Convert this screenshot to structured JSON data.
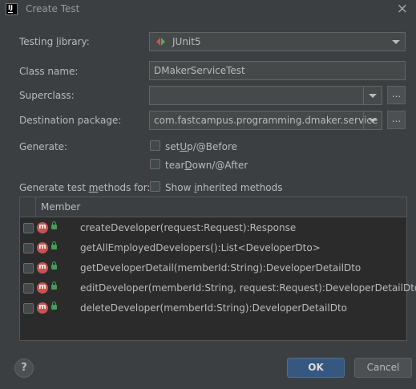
{
  "window": {
    "title": "Create Test",
    "app_icon_text": "IJ"
  },
  "form": {
    "testing_library": {
      "label_pre": "Testing ",
      "label_u": "l",
      "label_post": "ibrary:",
      "value": "JUnit5"
    },
    "class_name": {
      "label": "Class name:",
      "value": "DMakerServiceTest"
    },
    "superclass": {
      "label": "Superclass:",
      "value": ""
    },
    "destination_package": {
      "label": "Destination package:",
      "value": "com.fastcampus.programming.dmaker.service"
    },
    "browse_label": "...",
    "generate": {
      "label": "Generate:",
      "setup": {
        "pre": "set",
        "u": "U",
        "post": "p/@Before"
      },
      "teardown": {
        "pre": "tear",
        "u": "D",
        "post": "own/@After"
      }
    },
    "generate_methods": {
      "label_pre": "Generate test ",
      "label_u": "m",
      "label_post": "ethods for:"
    },
    "show_inherited": {
      "pre": "Show ",
      "u": "i",
      "post": "nherited methods"
    }
  },
  "members": {
    "header": "Member",
    "icon_letter": "m",
    "rows": [
      "createDeveloper(request:Request):Response",
      "getAllEmployedDevelopers():List<DeveloperDto>",
      "getDeveloperDetail(memberId:String):DeveloperDetailDto",
      "editDeveloper(memberId:String, request:Request):DeveloperDetailDto",
      "deleteDeveloper(memberId:String):DeveloperDetailDto"
    ]
  },
  "buttons": {
    "help": "?",
    "ok": "OK",
    "cancel": "Cancel"
  },
  "colors": {
    "background": "#3c3f41",
    "field": "#45494a",
    "accent": "#365880",
    "method_icon": "#c75450",
    "lock_icon": "#499c54"
  },
  "icons": [
    "app-icon",
    "close-icon",
    "junit-icon",
    "chevron-down-icon",
    "method-icon",
    "lock-icon",
    "help-icon"
  ]
}
